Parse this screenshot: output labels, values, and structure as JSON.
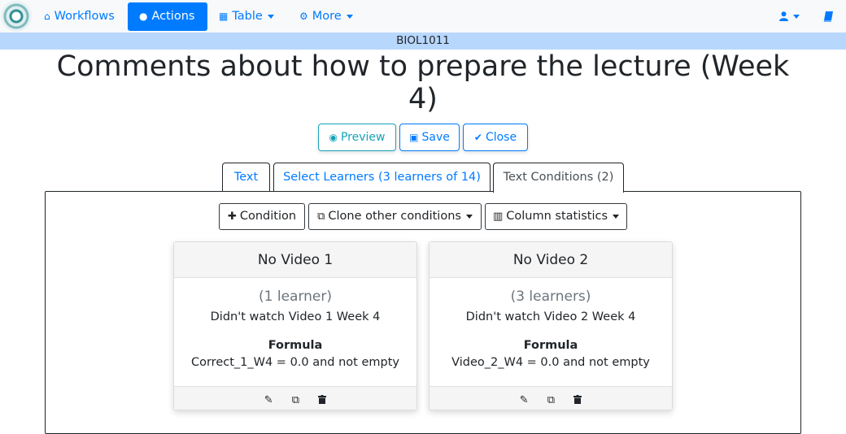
{
  "navbar": {
    "workflows": "Workflows",
    "actions": "Actions",
    "table": "Table",
    "more": "More"
  },
  "course": "BIOL1011",
  "title": "Comments about how to prepare the lecture (Week 4)",
  "buttons": {
    "preview": "Preview",
    "save": "Save",
    "close": "Close"
  },
  "tabs": [
    {
      "label": "Text"
    },
    {
      "label": "Select Learners (3 learners of 14)"
    },
    {
      "label": "Text Conditions (2)"
    }
  ],
  "toolbar": {
    "condition": "Condition",
    "clone": "Clone other conditions",
    "stats": "Column statistics"
  },
  "conditions": [
    {
      "name": "No Video 1",
      "count": "(1 learner)",
      "description": "Didn't watch Video 1 Week 4",
      "formula_label": "Formula",
      "formula": "Correct_1_W4 = 0.0 and not empty"
    },
    {
      "name": "No Video 2",
      "count": "(3 learners)",
      "description": "Didn't watch Video 2 Week 4",
      "formula_label": "Formula",
      "formula": "Video_2_W4 = 0.0 and not empty"
    }
  ],
  "colors": {
    "primary": "#007bff",
    "info": "#17a2b8",
    "course_bar": "#b8d7fc"
  }
}
